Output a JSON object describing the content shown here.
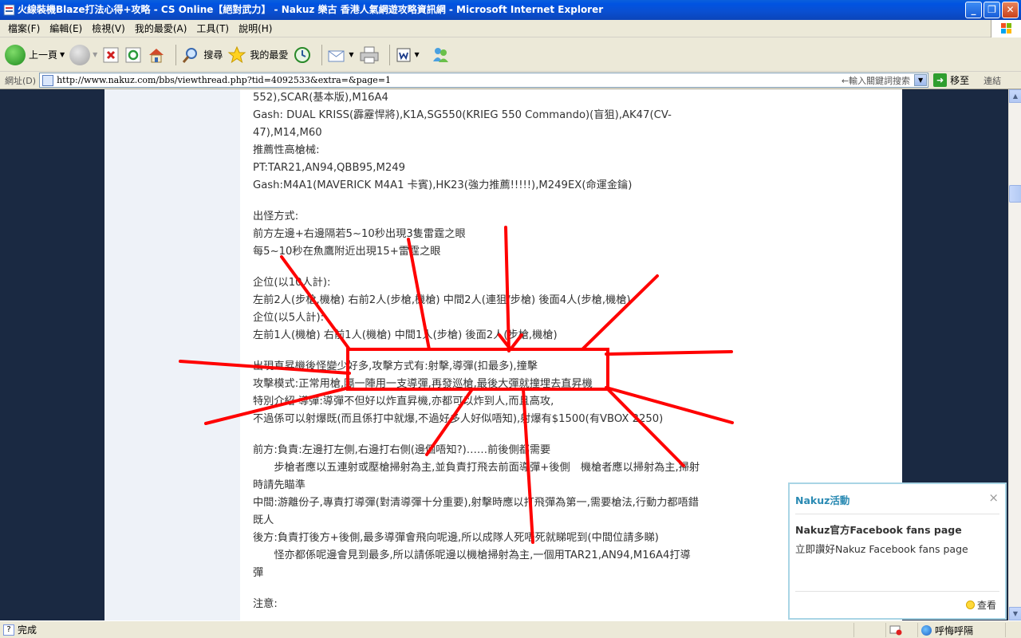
{
  "window": {
    "title": "火線裝機Blaze打法心得+攻略 - CS Online【絕對武力】 - Nakuz 樂古 香港人氣網遊攻略資訊網 - Microsoft Internet Explorer",
    "minimize": "_",
    "maximize": "❐",
    "close": "✕"
  },
  "menu": [
    "檔案(F)",
    "編輯(E)",
    "檢視(V)",
    "我的最愛(A)",
    "工具(T)",
    "說明(H)"
  ],
  "toolbar": {
    "back": "上一頁",
    "search": "搜尋",
    "favorites": "我的最愛",
    "dropdown": "▼"
  },
  "address": {
    "label": "網址(D)",
    "url": "http://www.nakuz.com/bbs/viewthread.php?tid=4092533&extra=&page=1",
    "hint": "←輸入關鍵詞搜索",
    "go": "移至",
    "go_icon": "➜",
    "links": "連結"
  },
  "post": {
    "lines": [
      "552),SCAR(基本版),M16A4",
      "Gash: DUAL KRISS(霹靂悍將),K1A,SG550(KRIEG 550 Commando)(盲狙),AK47(CV-",
      "47),M14,M60",
      "推薦性高槍械:",
      "PT:TAR21,AN94,QBB95,M249",
      "Gash:M4A1(MAVERICK M4A1 卡賓),HK23(強力推薦!!!!!),M249EX(命運金鑰)",
      "",
      "出怪方式:",
      "前方左邊+右邊隔若5~10秒出現3隻雷霆之眼",
      "每5~10秒在魚鷹附近出現15+雷霆之眼",
      "",
      "企位(以10人計):",
      "左前2人(步槍,機槍) 右前2人(步槍,機槍) 中間2人(連狙/步槍) 後面4人(步槍,機槍)",
      "企位(以5人計):",
      "左前1人(機槍) 右前1人(機槍) 中間1人(步槍) 後面2人(步槍,機槍)",
      "",
      "出現直昇機後怪變少好多,攻擊方式有:射擊,導彈(扣最多),撞擊",
      "攻擊模式:正常用槍,隔一陣用一支導彈,再發巡槍,最後大彈就撞埋去直昇機",
      "特別介紹 導彈:導彈不但好以炸直昇機,亦都可以炸到人,而且高攻,",
      "不過係可以射爆既(而且係打中就爆,不過好多人好似唔知),射爆有$1500(有VBOX 2250)",
      "",
      "前方:負責:左邊打左側,右邊打右側(邊個唔知?)……前後側都需要",
      "　　步槍者應以五連射或壓槍掃射為主,並負責打飛去前面導彈+後側　機槍者應以掃射為主,掃射",
      "時請先瞄準",
      "中間:游離份子,專責打導彈(對清導彈十分重要),射擊時應以打飛彈為第一,需要槍法,行動力都唔錯",
      "既人",
      "後方:負責打後方+後側,最多導彈會飛向呢邊,所以成隊人死唔死就睇呢到(中間位請多睇)",
      "　　怪亦都係呢邊會見到最多,所以請係呢邊以機槍掃射為主,一個用TAR21,AN94,M16A4打導",
      "彈",
      "",
      "注意:"
    ]
  },
  "popup": {
    "title": "Nakuz活動",
    "close": "×",
    "heading": "Nakuz官方Facebook fans page",
    "text": "立即讚好Nakuz Facebook fans page",
    "view": "查看"
  },
  "status": {
    "text": "完成",
    "zone": "呼悔呼隔"
  },
  "colors": {
    "annotation": "#ff0000",
    "background": "#1a2942",
    "popup_border": "#a9d5e5",
    "popup_title": "#2a8ab3"
  }
}
